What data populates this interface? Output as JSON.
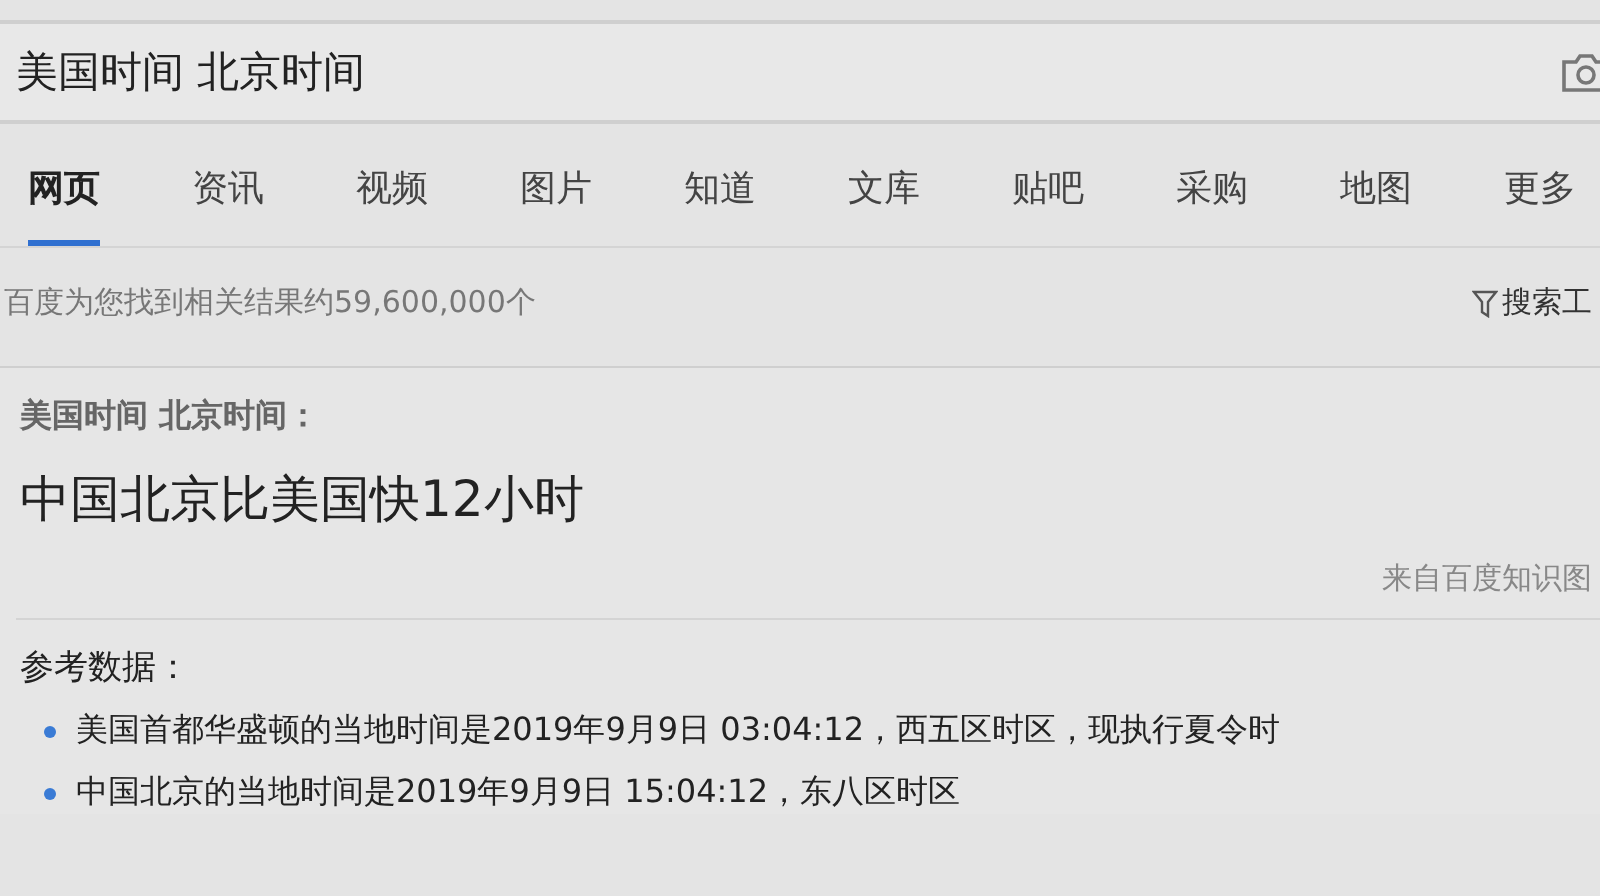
{
  "search": {
    "value": "美国时间 北京时间"
  },
  "tabs": [
    {
      "label": "网页",
      "selected": true
    },
    {
      "label": "资讯",
      "selected": false
    },
    {
      "label": "视频",
      "selected": false
    },
    {
      "label": "图片",
      "selected": false
    },
    {
      "label": "知道",
      "selected": false
    },
    {
      "label": "文库",
      "selected": false
    },
    {
      "label": "贴吧",
      "selected": false
    },
    {
      "label": "采购",
      "selected": false
    },
    {
      "label": "地图",
      "selected": false
    },
    {
      "label": "更多",
      "selected": false
    }
  ],
  "result_count": "百度为您找到相关结果约59,600,000个",
  "search_tools": "搜索工",
  "answer_card": {
    "query": "美国时间 北京时间：",
    "answer": "中国北京比美国快12小时",
    "source": "来自百度知识图",
    "reference_title": "参考数据：",
    "references": [
      "美国首都华盛顿的当地时间是2019年9月9日 03:04:12，西五区时区，现执行夏令时",
      "中国北京的当地时间是2019年9月9日 15:04:12，东八区时区"
    ]
  }
}
